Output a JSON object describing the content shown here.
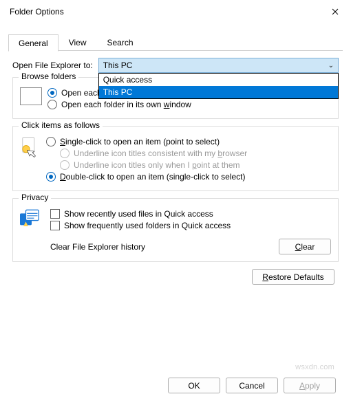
{
  "window": {
    "title": "Folder Options"
  },
  "tabs": {
    "general": "General",
    "view": "View",
    "search": "Search"
  },
  "open_explorer": {
    "label": "Open File Explorer to:",
    "selected": "This PC",
    "options": {
      "quick": "Quick access",
      "thispc": "This PC"
    }
  },
  "browse": {
    "legend": "Browse folders",
    "same_window": "Open each folder in the same window",
    "own_window": "Open each folder in its own window"
  },
  "click": {
    "legend": "Click items as follows",
    "single": "Single-click to open an item (point to select)",
    "underline_browser": "Underline icon titles consistent with my browser",
    "underline_point": "Underline icon titles only when I point at them",
    "double": "Double-click to open an item (single-click to select)"
  },
  "privacy": {
    "legend": "Privacy",
    "recent_files": "Show recently used files in Quick access",
    "freq_folders": "Show frequently used folders in Quick access",
    "clear_label": "Clear File Explorer history",
    "clear_btn": "Clear"
  },
  "buttons": {
    "restore": "Restore Defaults",
    "ok": "OK",
    "cancel": "Cancel",
    "apply": "Apply"
  },
  "watermark": "wsxdn.com"
}
